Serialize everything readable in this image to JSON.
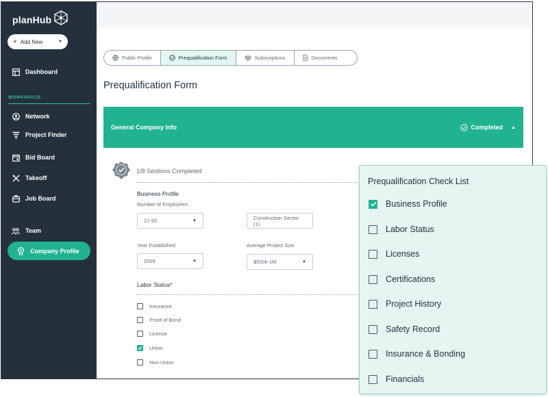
{
  "app": {
    "logo_text": "planHub"
  },
  "sidebar": {
    "add_new_label": "Add New",
    "workspace_label": "WORKSPACE",
    "items": [
      {
        "label": "Dashboard",
        "icon": "dashboard-icon"
      },
      {
        "label": "Network",
        "icon": "user-circle-icon"
      },
      {
        "label": "Project Finder",
        "icon": "filter-icon"
      },
      {
        "label": "Bid Board",
        "icon": "calendar-icon"
      },
      {
        "label": "Takeoff",
        "icon": "measure-icon"
      },
      {
        "label": "Job Board",
        "icon": "briefcase-icon"
      },
      {
        "label": "Team",
        "icon": "team-icon"
      },
      {
        "label": "Company Profile",
        "icon": "profile-badge-icon",
        "active": true
      }
    ]
  },
  "tabs": [
    {
      "label": "Public Profile",
      "icon": "globe-icon"
    },
    {
      "label": "Prequalification Form",
      "icon": "check-circle-icon",
      "active": true
    },
    {
      "label": "Subscriptions",
      "icon": "subscriptions-icon"
    },
    {
      "label": "Documents",
      "icon": "document-icon"
    }
  ],
  "page_title": "Prequalification Form",
  "section": {
    "title": "General Company Info",
    "status": "Completed",
    "progress_text": "1/8 Sections Completed"
  },
  "business_profile": {
    "heading": "Business Profile",
    "employees_label": "Number of Employees",
    "employees_value": "21-50",
    "sector_placeholder": "Construction Sector (1)",
    "year_label": "Year Established",
    "year_value": "2009",
    "project_size_label": "Average Project Size",
    "project_size_value": "$500k-1M"
  },
  "labor_status": {
    "heading": "Labor Status*",
    "options": [
      {
        "label": "Insurance",
        "checked": false
      },
      {
        "label": "Proof of Bond",
        "checked": false
      },
      {
        "label": "License",
        "checked": false
      },
      {
        "label": "Union",
        "checked": true
      },
      {
        "label": "Non-Union",
        "checked": false
      }
    ]
  },
  "checklist": {
    "title": "Prequalification Check List",
    "items": [
      {
        "label": "Business Profile",
        "checked": true
      },
      {
        "label": "Labor Status",
        "checked": false
      },
      {
        "label": "Licenses",
        "checked": false
      },
      {
        "label": "Certifications",
        "checked": false
      },
      {
        "label": "Project History",
        "checked": false
      },
      {
        "label": "Safety Record",
        "checked": false
      },
      {
        "label": "Insurance & Bonding",
        "checked": false
      },
      {
        "label": "Financials",
        "checked": false
      }
    ]
  },
  "colors": {
    "accent": "#21b38f",
    "sidebar": "#25303d",
    "panel_bg": "#e6f5f1"
  }
}
